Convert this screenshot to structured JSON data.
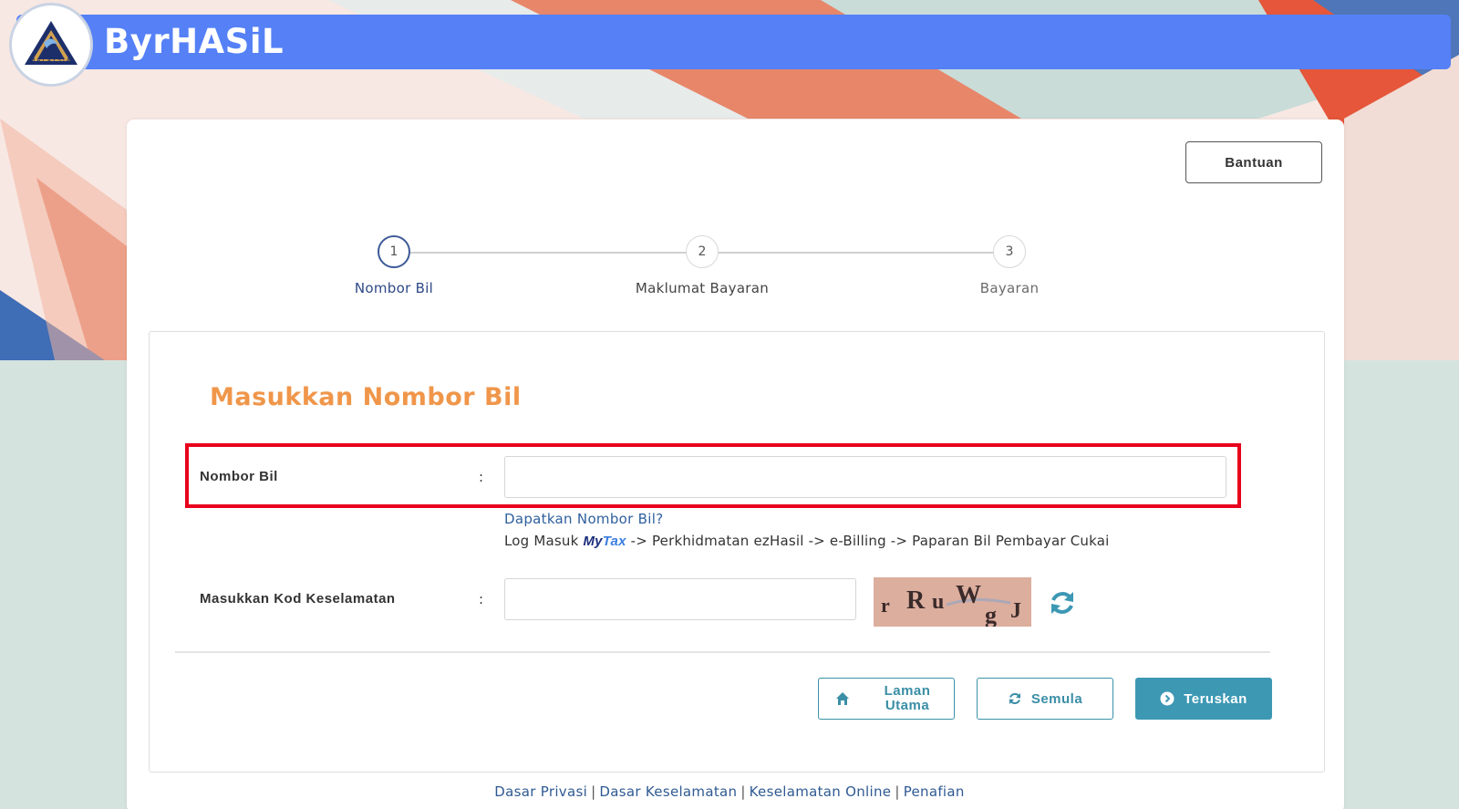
{
  "app": {
    "title": "ByrHASiL",
    "logo_text": "LHDN",
    "logo_subtext": "MALAYSIA"
  },
  "header": {
    "help_button": "Bantuan"
  },
  "stepper": {
    "steps": [
      {
        "number": "1",
        "label": "Nombor Bil",
        "state": "active"
      },
      {
        "number": "2",
        "label": "Maklumat Bayaran",
        "state": "pending"
      },
      {
        "number": "3",
        "label": "Bayaran",
        "state": "pending"
      }
    ]
  },
  "form": {
    "section_title": "Masukkan Nombor Bil",
    "bill_number": {
      "label": "Nombor Bil",
      "colon": ":",
      "value": "",
      "placeholder": ""
    },
    "help": {
      "link": "Dapatkan Nombor Bil?",
      "path_prefix": "Log Masuk",
      "mytax_my": "My",
      "mytax_tax": "Tax",
      "path_suffix": "-> Perkhidmatan ezHasil -> e-Billing -> Paparan Bil Pembayar Cukai"
    },
    "security_code": {
      "label": "Masukkan Kod Keselamatan",
      "colon": ":",
      "value": "",
      "placeholder": ""
    },
    "captcha": {
      "chars": [
        "r",
        "R",
        "u",
        "W",
        "g",
        "J"
      ]
    }
  },
  "actions": {
    "home": "Laman Utama",
    "home_line1": "Laman",
    "home_line2": "Utama",
    "reset": "Semula",
    "continue": "Teruskan"
  },
  "footer": {
    "links": [
      "Dasar Privasi",
      "Dasar Keselamatan",
      "Keselamatan Online",
      "Penafian"
    ],
    "separator": "|"
  },
  "colors": {
    "header": "#5580f6",
    "accent_title": "#f0964a",
    "highlight": "#e8001c",
    "primary_button": "#3d98b4",
    "link": "#2f5f9e"
  }
}
